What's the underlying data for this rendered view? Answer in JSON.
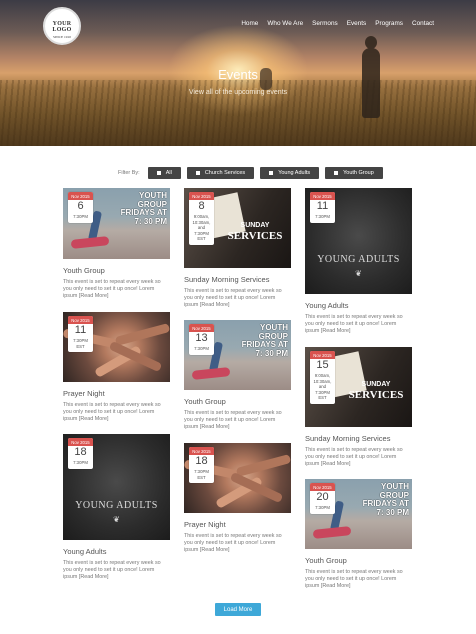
{
  "header": {
    "logo_line1": "YOUR LOGO",
    "logo_line2": "SINCE 1910",
    "nav": [
      "Home",
      "Who We Are",
      "Sermons",
      "Events",
      "Programs",
      "Contact"
    ],
    "title": "Events",
    "subtitle": "View all of the upcoming events"
  },
  "filter": {
    "label": "Filter By:",
    "buttons": [
      "All",
      "Church Services",
      "Young Adults",
      "Youth Group"
    ]
  },
  "cards": [
    {
      "month": "Nov 2015",
      "day": "6",
      "time": "7:30PM",
      "title": "Youth Group",
      "image": "skate",
      "img_text": "YOUTH GROUP FRIDAYS AT 7: 30 PM"
    },
    {
      "month": "Nov 2015",
      "day": "8",
      "time": "9:00am, 10:30am, and 7:30PM EST",
      "title": "Sunday Morning Services",
      "image": "bible",
      "img_text1": "SUNDAY",
      "img_text2": "SERVICES"
    },
    {
      "month": "Nov 2015",
      "day": "11",
      "time": "7:30PM",
      "title": "Young Adults",
      "image": "chalk",
      "img_text": "YOUNG ADULTS"
    },
    {
      "month": "Nov 2015",
      "day": "11",
      "time": "7:30PM EST",
      "title": "Prayer Night",
      "image": "hands"
    },
    {
      "month": "Nov 2015",
      "day": "13",
      "time": "7:30PM",
      "title": "Youth Group",
      "image": "skate",
      "img_text": "YOUTH GROUP FRIDAYS AT 7: 30 PM"
    },
    {
      "month": "Nov 2015",
      "day": "15",
      "time": "9:00am, 10:30am, and 7:30PM EST",
      "title": "Sunday Morning Services",
      "image": "bible",
      "img_text1": "SUNDAY",
      "img_text2": "SERVICES"
    },
    {
      "month": "Nov 2015",
      "day": "18",
      "time": "7:30PM",
      "title": "Young Adults",
      "image": "chalk",
      "img_text": "YOUNG ADULTS"
    },
    {
      "month": "Nov 2015",
      "day": "18",
      "time": "7:30PM EST",
      "title": "Prayer Night",
      "image": "hands"
    },
    {
      "month": "Nov 2015",
      "day": "20",
      "time": "7:30PM",
      "title": "Youth Group",
      "image": "skate",
      "img_text": "YOUTH GROUP FRIDAYS AT 7: 30 PM"
    }
  ],
  "description": "This event is set to repeat every week so you only need to set it up once! Lorem ipsum [Read More]",
  "load_more": "Load More"
}
